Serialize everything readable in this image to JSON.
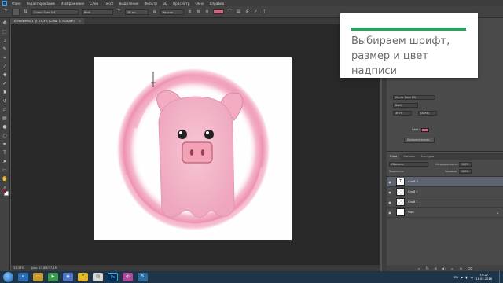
{
  "menu": {
    "app_logo": "Ps",
    "items": [
      "Файл",
      "Редактирование",
      "Изображение",
      "Слои",
      "Текст",
      "Выделение",
      "Фильтр",
      "3D",
      "Просмотр",
      "Окно",
      "Справка"
    ]
  },
  "options": {
    "font_family": "Comic Sans MS",
    "font_style": "Bold",
    "font_size": "36 пт",
    "antialias": "Резкое",
    "text_color": "#d4637f"
  },
  "document": {
    "tab_title": "Без имени-1 @ 33,3% (Слой 1, RGB/8*)",
    "tab_close": "×"
  },
  "status": {
    "zoom": "33,33%",
    "doc_size": "Док: 23,8M/37,1M"
  },
  "callout": {
    "line1": "Выбираем шрифт,",
    "line2": "размер и цвет надписи",
    "accent": "#21a75a"
  },
  "character_panel": {
    "font_family": "Comic Sans MS",
    "font_style": "Bold",
    "font_size": "36 пт",
    "leading": "(Авто)",
    "color_label": "Цвет:",
    "color": "#d4637f",
    "btn_label": "Дополнительно..."
  },
  "layers": {
    "tabs": [
      "Слои",
      "Каналы",
      "Контуры"
    ],
    "blend_mode": "Обычные",
    "opacity_label": "Непрозрачность:",
    "opacity": "100%",
    "lock_label": "Закрепить:",
    "fill_label": "Заливка:",
    "fill": "100%",
    "items": [
      {
        "name": "Слой 3",
        "thumb": "T"
      },
      {
        "name": "Слой 2",
        "thumb": ""
      },
      {
        "name": "Слой 1",
        "thumb": ""
      },
      {
        "name": "Фон",
        "thumb": ""
      }
    ]
  },
  "taskbar": {
    "lang": "EN",
    "time": "19:22",
    "date": "16.02.2016"
  }
}
